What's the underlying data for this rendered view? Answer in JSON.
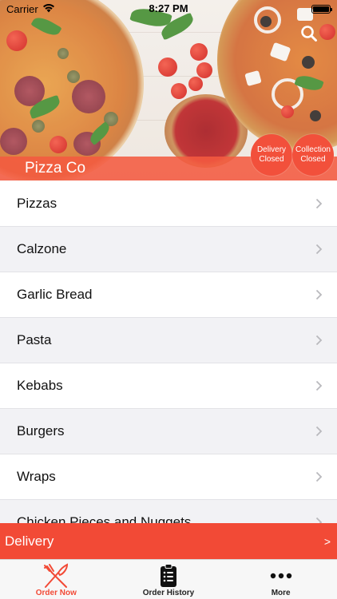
{
  "status_bar": {
    "carrier": "Carrier",
    "time": "8:27 PM"
  },
  "header": {
    "restaurant_name": "Pizza Co",
    "search_icon": "search-icon",
    "delivery_status": {
      "line1": "Delivery",
      "line2": "Closed"
    },
    "collection_status": {
      "line1": "Collection",
      "line2": "Closed"
    }
  },
  "categories": [
    {
      "label": "Pizzas"
    },
    {
      "label": "Calzone"
    },
    {
      "label": "Garlic Bread"
    },
    {
      "label": "Pasta"
    },
    {
      "label": "Kebabs"
    },
    {
      "label": "Burgers"
    },
    {
      "label": "Wraps"
    },
    {
      "label": "Chicken Pieces and Nuggets"
    }
  ],
  "delivery_bar": {
    "label": "Delivery",
    "arrow": ">"
  },
  "tabs": [
    {
      "label": "Order Now",
      "icon": "fork-knife-icon",
      "active": true
    },
    {
      "label": "Order History",
      "icon": "clipboard-list-icon",
      "active": false
    },
    {
      "label": "More",
      "icon": "more-dots-icon",
      "active": false
    }
  ],
  "colors": {
    "accent": "#f24a36",
    "list_alt_background": "#f2f2f5"
  }
}
